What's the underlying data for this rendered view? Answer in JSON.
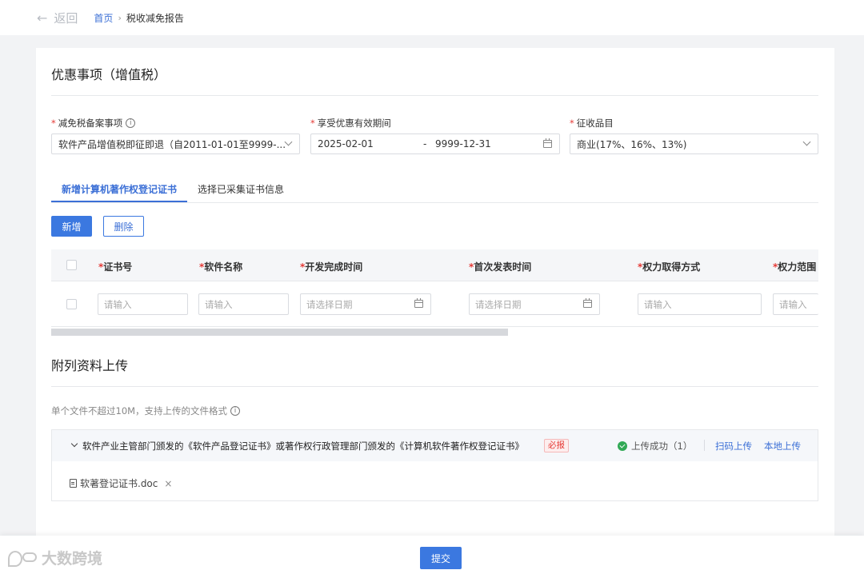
{
  "header": {
    "back_label": "返回",
    "breadcrumb": {
      "home": "首页",
      "separator": "›",
      "current": "税收减免报告"
    }
  },
  "section1": {
    "title": "优惠事项（增值税）",
    "fields": {
      "filing_item": {
        "label": "减免税备案事项",
        "value": "软件产品增值税即征即退（自2011-01-01至9999-..."
      },
      "validity": {
        "label": "享受优惠有效期间",
        "start": "2025-02-01",
        "separator": "-",
        "end": "9999-12-31"
      },
      "tax_category": {
        "label": "征收品目",
        "value": "商业(17%、16%、13%)"
      }
    }
  },
  "tabs": [
    {
      "label": "新增计算机著作权登记证书",
      "active": true
    },
    {
      "label": "选择已采集证书信息",
      "active": false
    }
  ],
  "toolbar": {
    "add_label": "新增",
    "delete_label": "删除"
  },
  "table": {
    "columns": [
      "证书号",
      "软件名称",
      "开发完成时间",
      "首次发表时间",
      "权力取得方式",
      "权力范围"
    ],
    "required_mark": "*",
    "row_placeholders": {
      "text": "请输入",
      "date": "请选择日期"
    }
  },
  "section2": {
    "title": "附列资料上传",
    "hint": "单个文件不超过10M，支持上传的文件格式",
    "upload_item": {
      "title": "软件产业主管部门颁发的《软件产品登记证书》或著作权行政管理部门颁发的《计算机软件著作权登记证书》",
      "required_tag": "必报",
      "status": "上传成功（1）",
      "scan_upload": "扫码上传",
      "local_upload": "本地上传",
      "file_name": "软著登记证书.doc"
    }
  },
  "footer": {
    "submit_label": "提交",
    "watermark": "大数跨境"
  },
  "colors": {
    "primary": "#3b78e0",
    "link": "#3b6fd6",
    "required": "#e53935",
    "success": "#31a955"
  }
}
